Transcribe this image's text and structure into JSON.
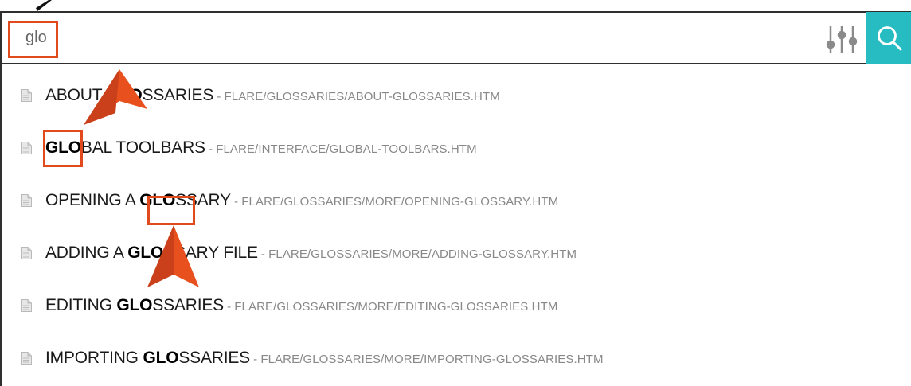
{
  "search": {
    "value": "glo",
    "placeholder": "",
    "highlight_color": "#e04a1c",
    "button_color": "#27bcc2"
  },
  "icons": {
    "filter": "sliders-icon",
    "search": "search-icon",
    "result": "document-icon"
  },
  "results": [
    {
      "pre": "ABOUT ",
      "match": "GLO",
      "post": "SSARIES",
      "sep": " - ",
      "path": "FLARE/GLOSSARIES/ABOUT-GLOSSARIES.HTM"
    },
    {
      "pre": "",
      "match": "GLO",
      "post": "BAL TOOLBARS",
      "sep": " - ",
      "path": "FLARE/INTERFACE/GLOBAL-TOOLBARS.HTM"
    },
    {
      "pre": "OPENING A ",
      "match": "GLO",
      "post": "SSARY",
      "sep": " - ",
      "path": "FLARE/GLOSSARIES/MORE/OPENING-GLOSSARY.HTM"
    },
    {
      "pre": "ADDING A ",
      "match": "GLO",
      "post": "SSARY FILE",
      "sep": " - ",
      "path": "FLARE/GLOSSARIES/MORE/ADDING-GLOSSARY.HTM"
    },
    {
      "pre": "EDITING ",
      "match": "GLO",
      "post": "SSARIES",
      "sep": " - ",
      "path": "FLARE/GLOSSARIES/MORE/EDITING-GLOSSARIES.HTM"
    },
    {
      "pre": "IMPORTING ",
      "match": "GLO",
      "post": "SSARIES",
      "sep": " - ",
      "path": "FLARE/GLOSSARIES/MORE/IMPORTING-GLOSSARIES.HTM"
    }
  ]
}
